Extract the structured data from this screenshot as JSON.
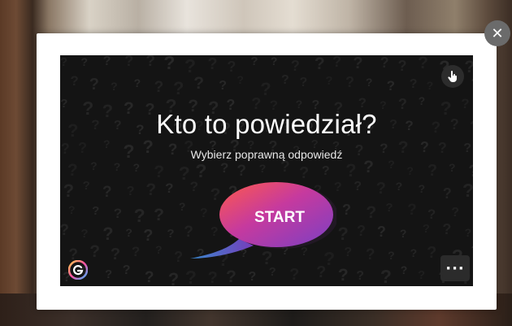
{
  "game": {
    "title": "Kto to powiedział?",
    "subtitle": "Wybierz poprawną odpowiedź",
    "start_label": "START",
    "pattern_glyph": "?"
  },
  "controls": {
    "close_icon": "close-icon",
    "touch_icon": "touch-hand-icon",
    "more_label": "···",
    "logo_icon": "genially-logo-icon"
  },
  "colors": {
    "overlay_bg": "#141414",
    "bubble_gradient": [
      "#ff5a4a",
      "#c63a9e",
      "#7b3fc4",
      "#3a8fd8"
    ]
  }
}
